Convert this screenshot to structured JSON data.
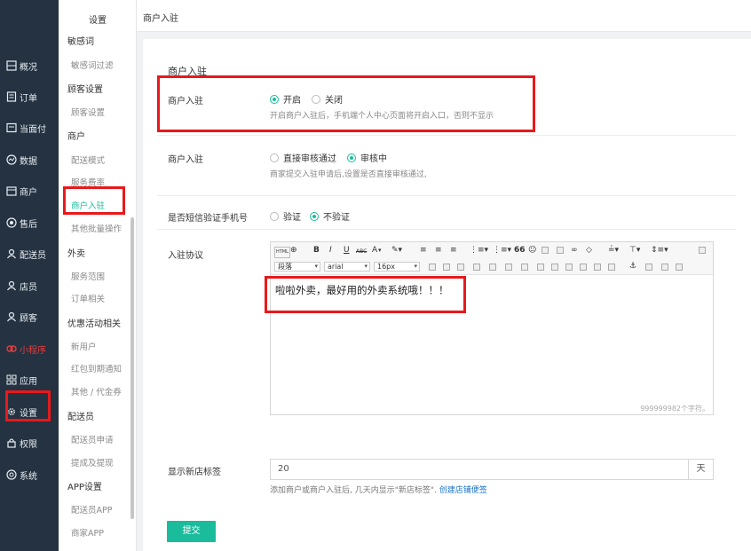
{
  "sidebar": {
    "items": [
      {
        "label": "概况",
        "icon": "overview-icon"
      },
      {
        "label": "订单",
        "icon": "order-icon"
      },
      {
        "label": "当面付",
        "icon": "face-pay-icon"
      },
      {
        "label": "数据",
        "icon": "data-icon"
      },
      {
        "label": "商户",
        "icon": "merchant-icon"
      },
      {
        "label": "售后",
        "icon": "after-sale-icon"
      },
      {
        "label": "配送员",
        "icon": "courier-icon"
      },
      {
        "label": "店员",
        "icon": "clerk-icon"
      },
      {
        "label": "顾客",
        "icon": "customer-icon"
      },
      {
        "label": "小程序",
        "icon": "mini-program-icon",
        "highlight_color": "#e53e3e"
      },
      {
        "label": "应用",
        "icon": "apps-icon"
      },
      {
        "label": "设置",
        "icon": "settings-icon"
      },
      {
        "label": "权限",
        "icon": "lock-icon"
      },
      {
        "label": "系统",
        "icon": "system-icon"
      }
    ]
  },
  "subnav": {
    "title": "设置",
    "groups": [
      {
        "head": "敏感词",
        "links": [
          "敏感词过滤"
        ]
      },
      {
        "head": "顾客设置",
        "links": [
          "顾客设置"
        ]
      },
      {
        "head": "商户",
        "links": [
          "配送模式",
          "服务费率",
          "商户入驻",
          "其他批量操作"
        ]
      },
      {
        "head": "外卖",
        "links": [
          "服务范围",
          "订单相关"
        ]
      },
      {
        "head": "优惠活动相关",
        "links": [
          "新用户",
          "红包到期通知",
          "其他 / 代金券"
        ]
      },
      {
        "head": "配送员",
        "links": [
          "配送员申请",
          "提成及提现"
        ]
      },
      {
        "head": "APP设置",
        "links": [
          "配送员APP",
          "商家APP"
        ]
      }
    ],
    "active_link": "商户入驻"
  },
  "topbar": {
    "breadcrumb": "商户入驻"
  },
  "form": {
    "section_title": "商户入驻",
    "merchant_entry": {
      "label": "商户入驻",
      "options": [
        "开启",
        "关闭"
      ],
      "selected": "开启",
      "help": "开启商户入驻后，手机端个人中心页面将开启入口，否则不显示"
    },
    "review": {
      "label": "商户入驻",
      "options": [
        "直接审核通过",
        "审核中"
      ],
      "selected": "审核中",
      "help": "商家提交入驻申请后,设置是否直接审核通过,"
    },
    "sms_verify": {
      "label": "是否短信验证手机号",
      "options": [
        "验证",
        "不验证"
      ],
      "selected": "不验证"
    },
    "agreement": {
      "label": "入驻协议",
      "toolbar": {
        "row1": [
          "HTML",
          "B",
          "I",
          "U",
          "ABC",
          "A",
          "66"
        ],
        "paragraph": "段落",
        "font": "arial",
        "size": "16px"
      },
      "content": "啦啦外卖，最好用的外卖系统哦！！！",
      "counter": "999999982个字符。"
    },
    "new_store_tag": {
      "label": "显示新店标签",
      "value": "20",
      "addon": "天",
      "help_prefix": "添加商户或商户入驻后, 几天内显示\"新店标签\".",
      "help_link": "创建店铺便签"
    },
    "submit_label": "提交"
  },
  "colors": {
    "sidebar_bg": "#243241",
    "accent": "#1abc9c",
    "annotation_red": "#e8191c",
    "link": "#1a73c8"
  }
}
